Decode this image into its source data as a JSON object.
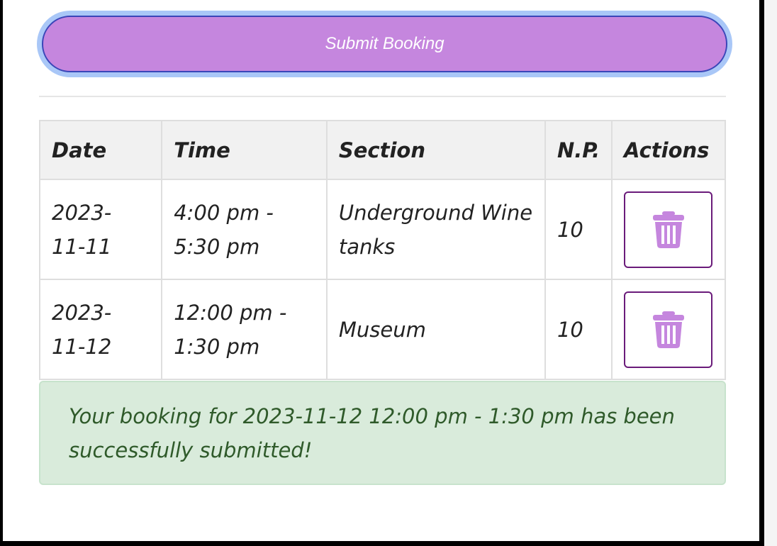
{
  "submit": {
    "label": "Submit Booking"
  },
  "table": {
    "headers": [
      "Date",
      "Time",
      "Section",
      "N.P.",
      "Actions"
    ],
    "rows": [
      {
        "date": "2023-11-11",
        "time": "4:00 pm - 5:30 pm",
        "section": "Underground Wine tanks",
        "np": "10",
        "action_icon": "trash-icon"
      },
      {
        "date": "2023-11-12",
        "time": "12:00 pm - 1:30 pm",
        "section": "Museum",
        "np": "10",
        "action_icon": "trash-icon"
      }
    ]
  },
  "alert": {
    "message": "Your booking for 2023-11-12 12:00 pm - 1:30 pm has been successfully submitted!"
  },
  "colors": {
    "submit_bg": "#c586de",
    "focus_ring": "#a9c7f7",
    "delete_border": "#6a1b7a",
    "trash_icon": "#c586de",
    "alert_bg": "#d9ebdb",
    "alert_text": "#2f5a2a"
  }
}
